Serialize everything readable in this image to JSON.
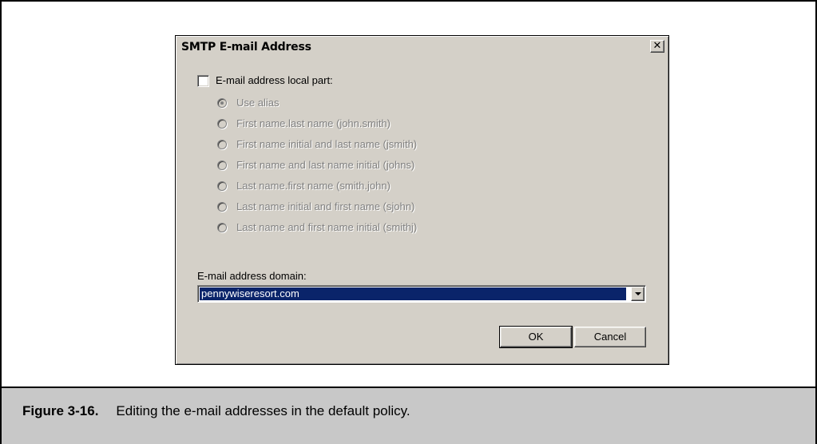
{
  "dialog": {
    "title": "SMTP E-mail Address",
    "close_glyph": "✕",
    "local_part": {
      "checkbox_label": "E-mail address local part:",
      "checked": false,
      "options": [
        {
          "label": "Use alias",
          "selected": true
        },
        {
          "label": "First name.last name (john.smith)",
          "selected": false
        },
        {
          "label": "First name initial and last name (jsmith)",
          "selected": false
        },
        {
          "label": "First name and last name initial (johns)",
          "selected": false
        },
        {
          "label": "Last name.first name (smith.john)",
          "selected": false
        },
        {
          "label": "Last name initial and first name (sjohn)",
          "selected": false
        },
        {
          "label": "Last name and first name initial (smithj)",
          "selected": false
        }
      ]
    },
    "domain": {
      "label": "E-mail address domain:",
      "value": "pennywiseresort.com"
    },
    "buttons": {
      "ok": "OK",
      "cancel": "Cancel"
    }
  },
  "figure": {
    "number": "Figure 3-16.",
    "caption": "Editing the e-mail addresses in the default policy."
  },
  "colors": {
    "dialog_bg": "#d4d0c8",
    "selection": "#0a246a",
    "caption_band": "#c8c8c8"
  }
}
